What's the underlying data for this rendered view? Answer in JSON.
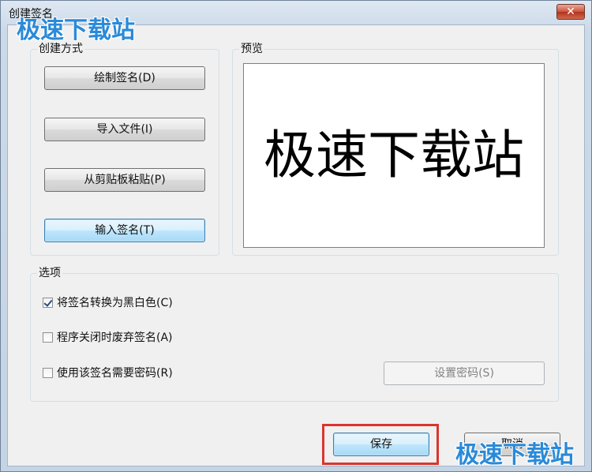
{
  "window": {
    "title": "创建签名",
    "close_label": "✕"
  },
  "create_method": {
    "label": "创建方式",
    "buttons": [
      {
        "label": "绘制签名(D)"
      },
      {
        "label": "导入文件(I)"
      },
      {
        "label": "从剪贴板粘贴(P)"
      },
      {
        "label": "输入签名(T)"
      }
    ]
  },
  "preview": {
    "label": "预览",
    "text": "极速下载站"
  },
  "options": {
    "label": "选项",
    "items": [
      {
        "label": "将签名转换为黑白色(C)",
        "checked": true
      },
      {
        "label": "程序关闭时废弃签名(A)",
        "checked": false
      },
      {
        "label": "使用该签名需要密码(R)",
        "checked": false
      }
    ],
    "set_password_label": "设置密码(S)"
  },
  "footer": {
    "save_label": "保存",
    "cancel_label": "取消"
  },
  "watermark": {
    "text": "极速下载站",
    "color": "#2a8ad8"
  },
  "colors": {
    "highlight_border": "#d9362e",
    "focused_button_border": "#3c7fb1"
  }
}
